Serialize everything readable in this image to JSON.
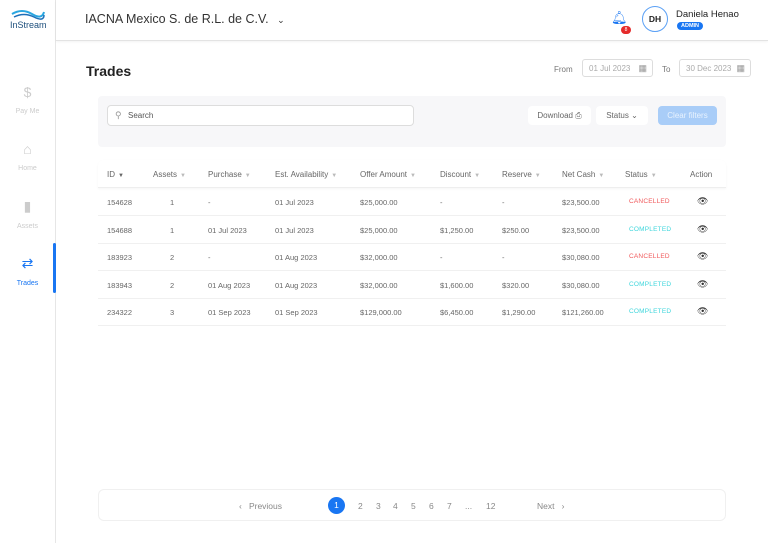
{
  "app": {
    "logo": "InStream"
  },
  "sidebar": {
    "items": [
      {
        "label": "Pay Me",
        "icon": "dollar-icon"
      },
      {
        "label": "Home",
        "icon": "home-icon"
      },
      {
        "label": "Assets",
        "icon": "document-icon"
      },
      {
        "label": "Trades",
        "icon": "swap-arrows-icon",
        "active": true
      }
    ]
  },
  "header": {
    "company": "IACNA Mexico S. de R.L. de C.V.",
    "notifications": "8",
    "user_initials": "DH",
    "user_name": "Daniela Henao",
    "role": "ADMIN"
  },
  "page": {
    "title": "Trades",
    "from_label": "From",
    "from_value": "01 Jul 2023",
    "to_label": "To",
    "to_value": "30 Dec 2023"
  },
  "filters": {
    "search_placeholder": "Search",
    "download": "Download",
    "status": "Status",
    "clear": "Clear filters"
  },
  "table": {
    "columns": [
      "ID",
      "Assets",
      "Purchase",
      "Est. Availability",
      "Offer Amount",
      "Discount",
      "Reserve",
      "Net Cash",
      "Status",
      "Action"
    ],
    "rows": [
      [
        "154628",
        "1",
        "-",
        "01 Jul 2023",
        "$25,000.00",
        "-",
        "-",
        "$23,500.00",
        "CANCELLED"
      ],
      [
        "154688",
        "1",
        "01 Jul 2023",
        "01 Jul 2023",
        "$25,000.00",
        "$1,250.00",
        "$250.00",
        "$23,500.00",
        "COMPLETED"
      ],
      [
        "183923",
        "2",
        "-",
        "01 Aug 2023",
        "$32,000.00",
        "-",
        "-",
        "$30,080.00",
        "CANCELLED"
      ],
      [
        "183943",
        "2",
        "01 Aug 2023",
        "01 Aug 2023",
        "$32,000.00",
        "$1,600.00",
        "$320.00",
        "$30,080.00",
        "COMPLETED"
      ],
      [
        "234322",
        "3",
        "01 Sep 2023",
        "01 Sep 2023",
        "$129,000.00",
        "$6,450.00",
        "$1,290.00",
        "$121,260.00",
        "COMPLETED"
      ]
    ]
  },
  "pagination": {
    "previous": "Previous",
    "next": "Next",
    "pages": [
      "1",
      "2",
      "3",
      "4",
      "5",
      "6",
      "7",
      "...",
      "12"
    ],
    "current": "1"
  },
  "colors": {
    "accent": "#1976f2",
    "cancelled": "#f0595b",
    "completed": "#3fd6dc"
  }
}
